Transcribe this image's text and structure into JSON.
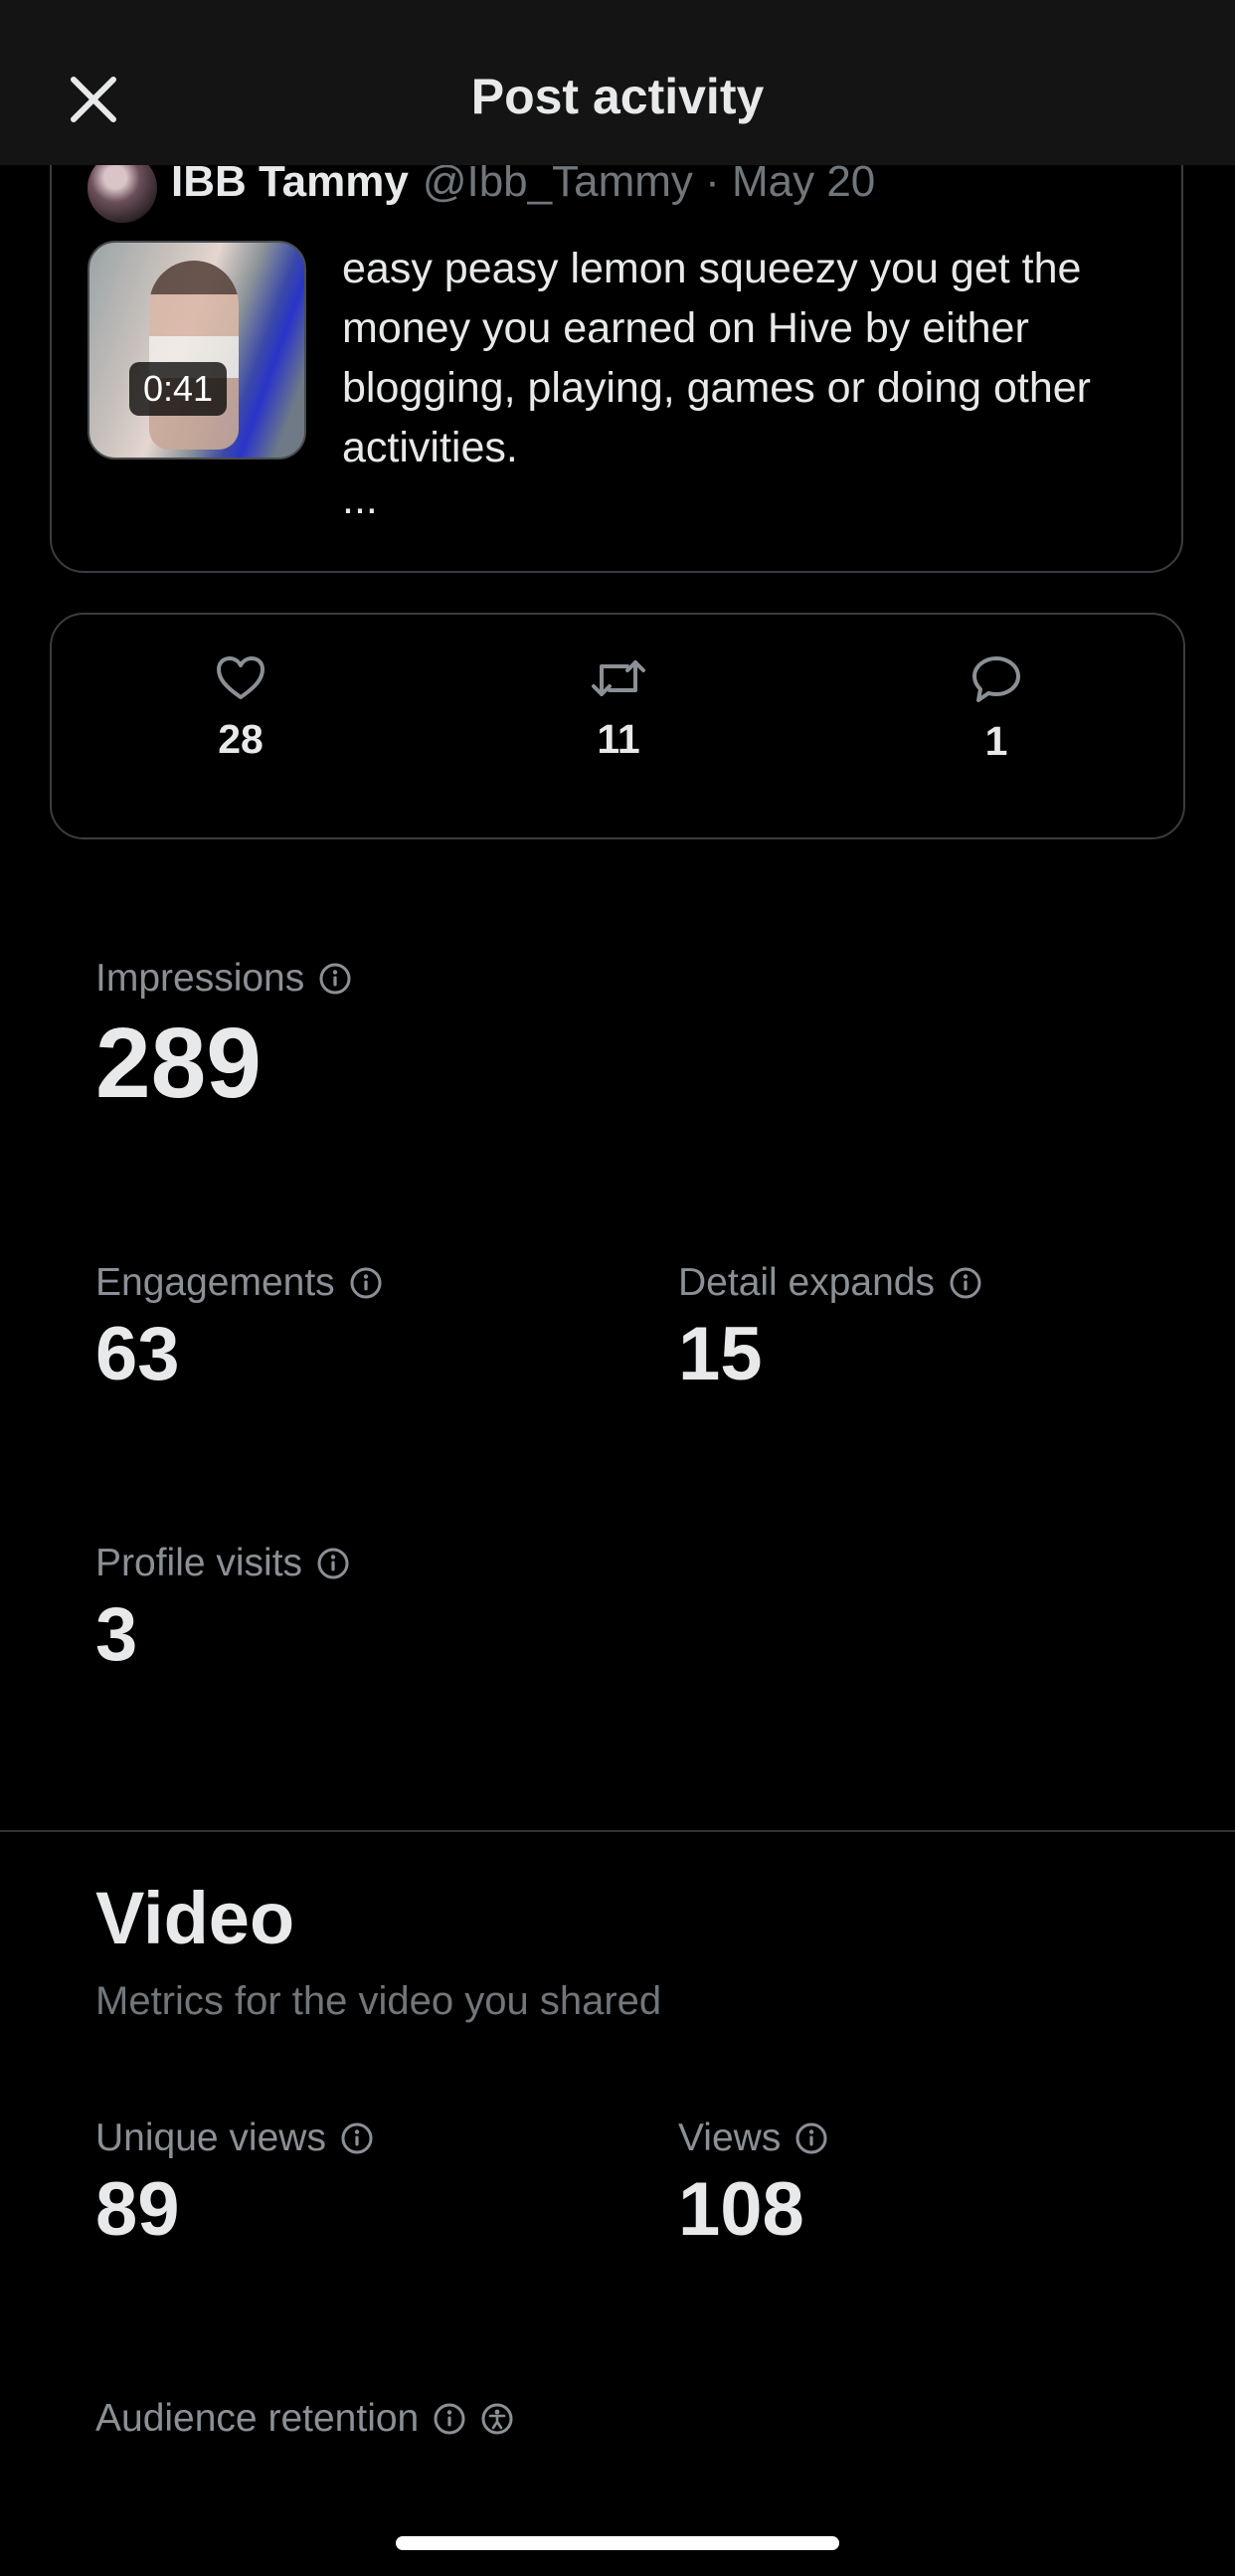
{
  "header": {
    "title": "Post activity",
    "close_icon": "close-icon"
  },
  "post": {
    "author_name": "IBB Tammy",
    "author_meta": "@Ibb_Tammy · May 20",
    "video_duration": "0:41",
    "text": "easy peasy lemon squeezy you get the money you earned on Hive by either blogging, playing, games or doing other activities.",
    "ellipsis": "..."
  },
  "stats": {
    "likes": "28",
    "reposts": "11",
    "replies": "1"
  },
  "metrics": {
    "impressions": {
      "label": "Impressions",
      "value": "289"
    },
    "engagements": {
      "label": "Engagements",
      "value": "63"
    },
    "detail_expands": {
      "label": "Detail expands",
      "value": "15"
    },
    "profile_visits": {
      "label": "Profile visits",
      "value": "3"
    }
  },
  "video": {
    "title": "Video",
    "subtitle": "Metrics for the video you shared",
    "unique_views": {
      "label": "Unique views",
      "value": "89"
    },
    "views": {
      "label": "Views",
      "value": "108"
    },
    "audience_retention": {
      "label": "Audience retention"
    }
  },
  "colors": {
    "background": "#000000",
    "header_bg": "#141414",
    "text_primary": "#e7e9ea",
    "text_secondary": "#71767b",
    "border": "#3a3d40"
  }
}
